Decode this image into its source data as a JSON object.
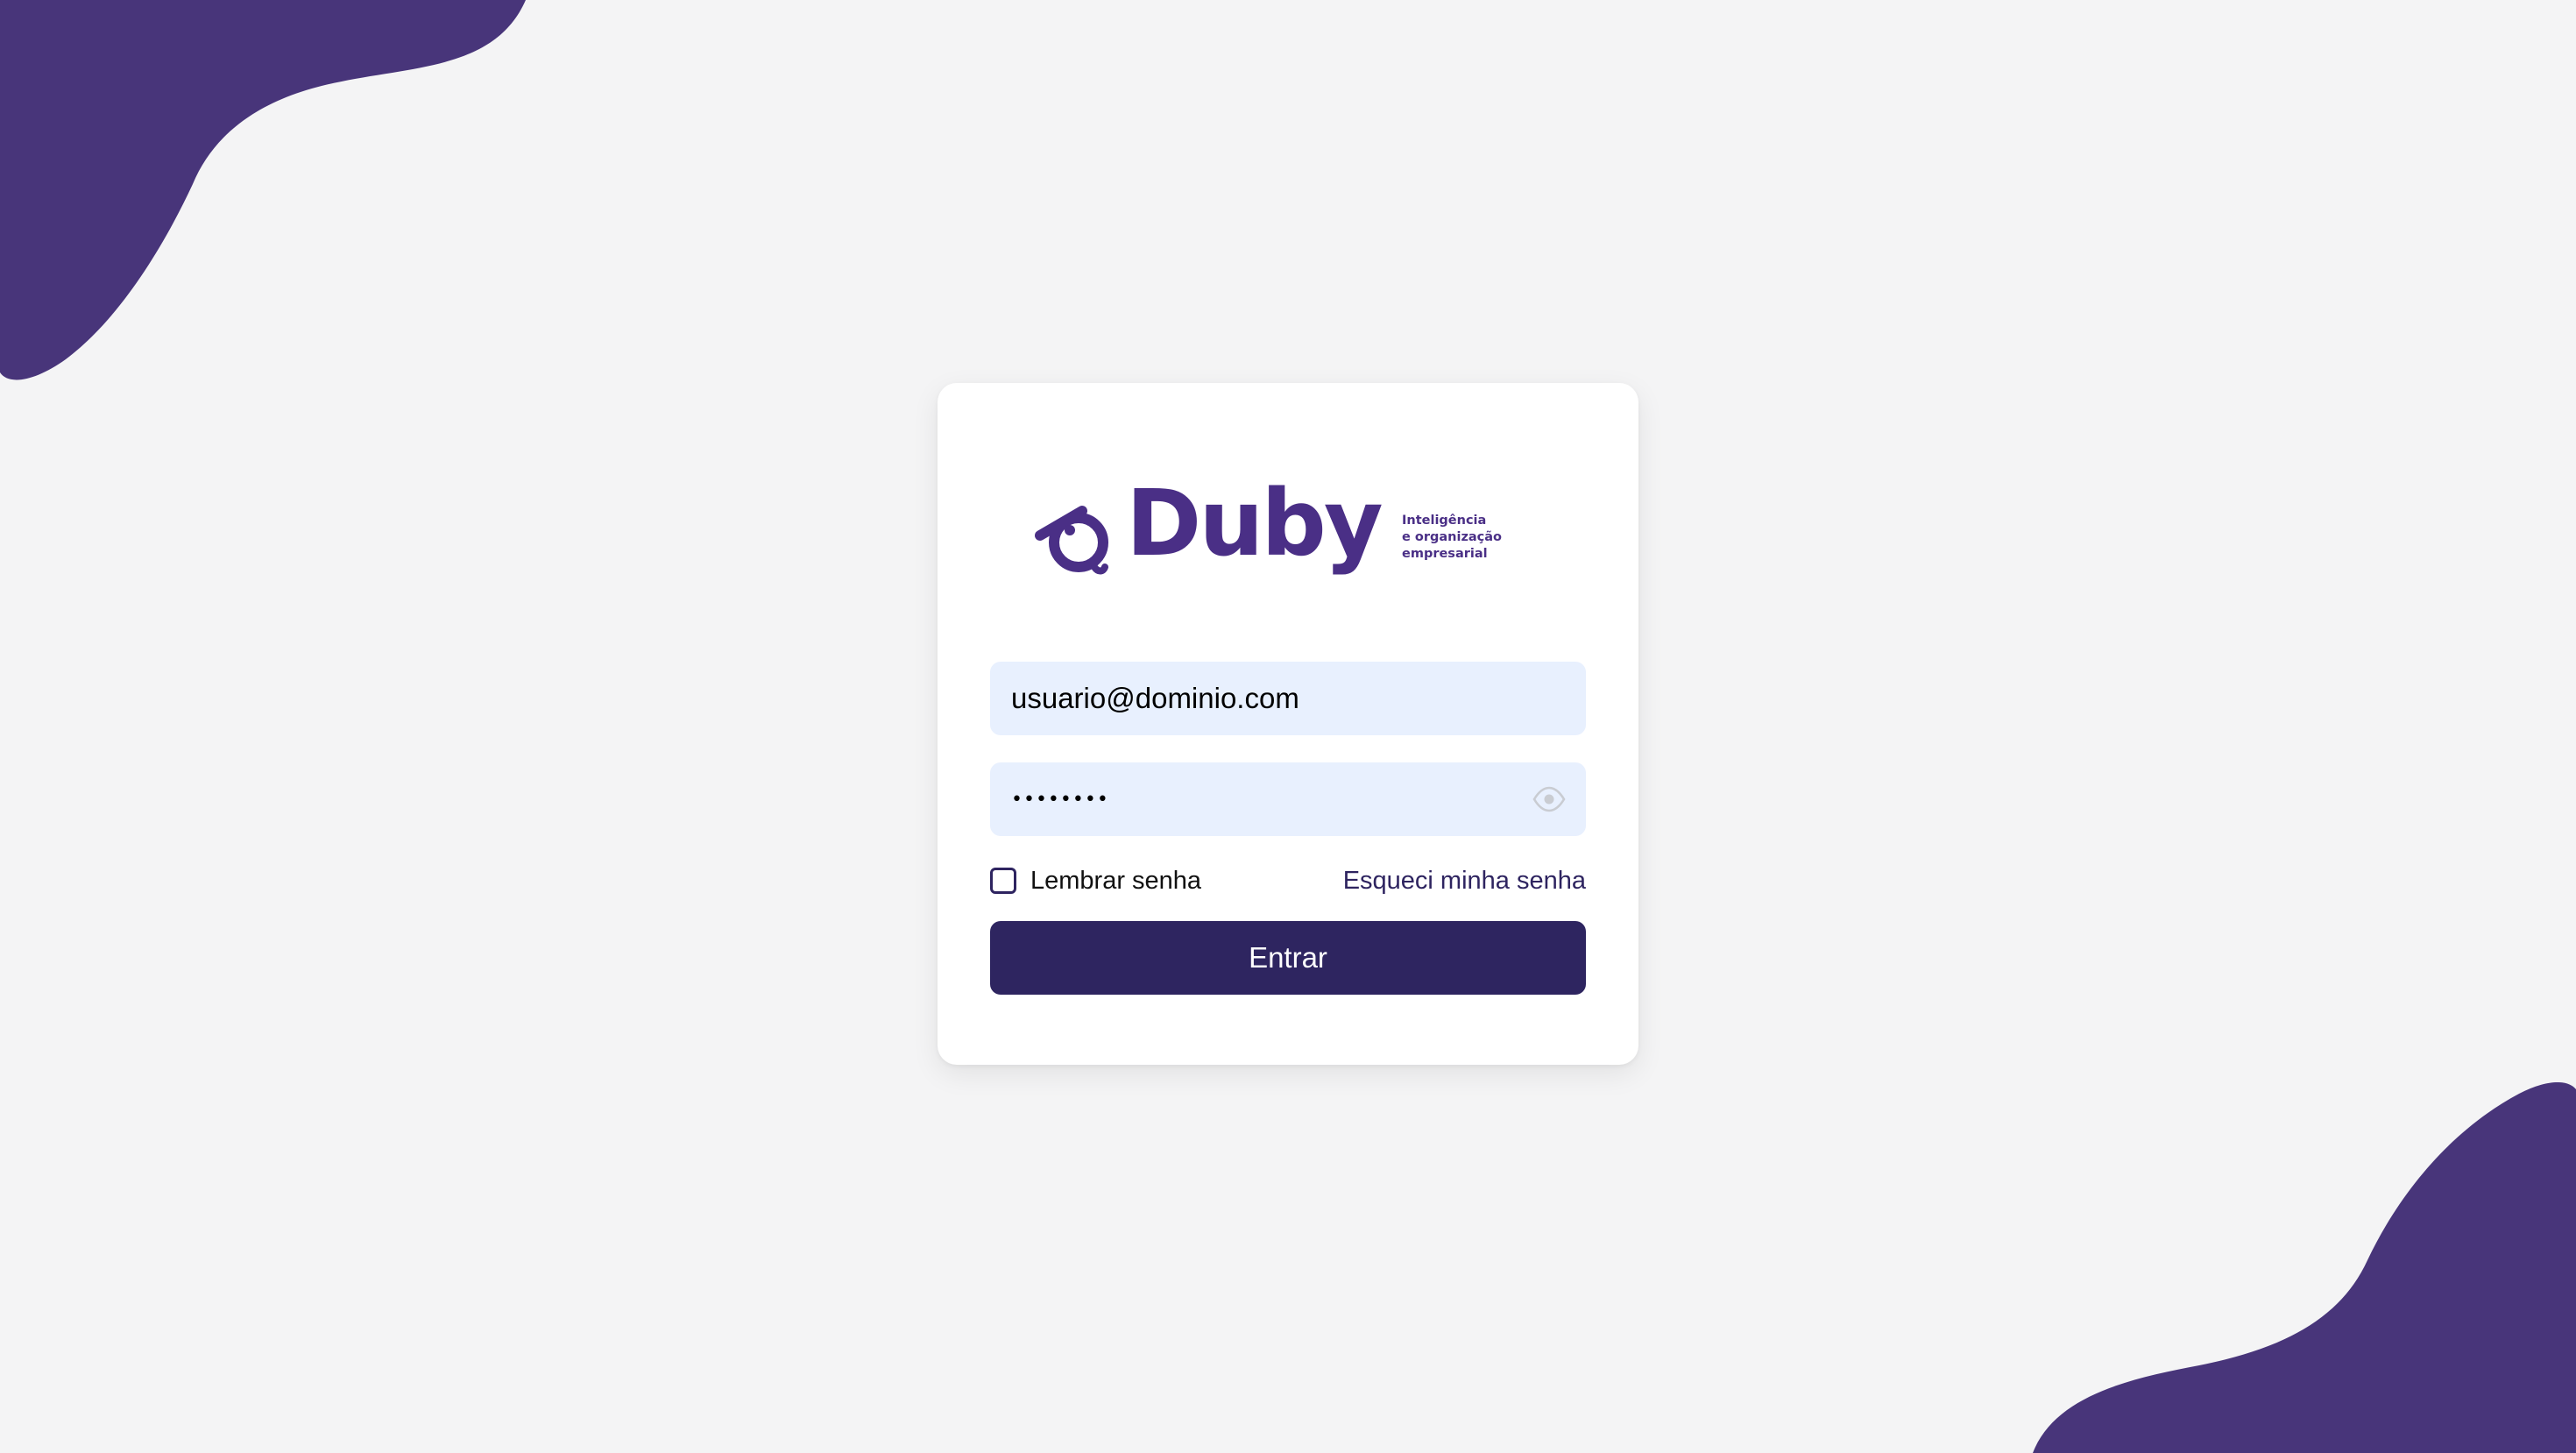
{
  "brand": {
    "name": "Duby",
    "tagline": [
      "Inteligência",
      "e organização",
      "empresarial"
    ]
  },
  "form": {
    "email_value": "usuario@dominio.com",
    "password_value": "12345678",
    "show_password_icon": "eye-icon",
    "remember_label": "Lembrar senha",
    "remember_checked": false,
    "forgot_label": "Esqueci minha senha",
    "submit_label": "Entrar"
  },
  "colors": {
    "brand_purple": "#48357a",
    "logo_purple": "#4a2f86",
    "button_bg": "#2e2560",
    "input_bg": "#e8f0fe",
    "page_bg": "#f4f4f5"
  }
}
